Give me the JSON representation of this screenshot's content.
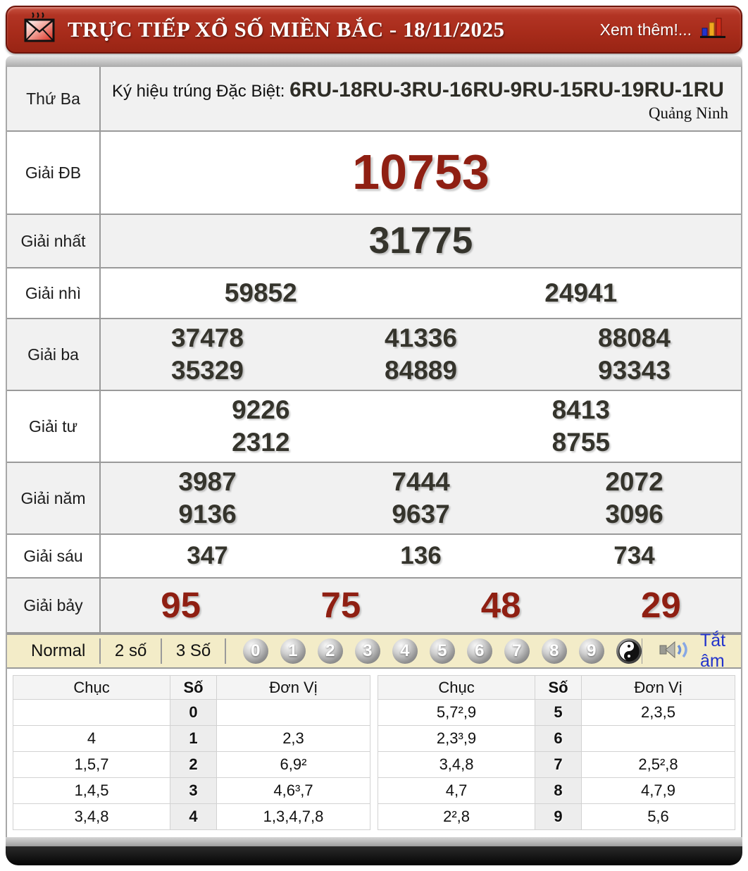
{
  "header": {
    "title": "TRỰC TIẾP XỔ SỐ MIỀN BẮC - 18/11/2025",
    "more_label": "Xem thêm!..."
  },
  "info_row": {
    "day": "Thứ Ba",
    "symbol_label": "Ký hiệu trúng Đặc Biệt: ",
    "symbol_codes": "6RU-18RU-3RU-16RU-9RU-15RU-19RU-1RU",
    "province": "Quảng Ninh"
  },
  "prizes": [
    {
      "key": "db",
      "label": "Giải ĐB",
      "rows": [
        [
          "10753"
        ]
      ]
    },
    {
      "key": "nhat",
      "label": "Giải nhất",
      "rows": [
        [
          "31775"
        ]
      ]
    },
    {
      "key": "nhi",
      "label": "Giải nhì",
      "rows": [
        [
          "59852",
          "24941"
        ]
      ]
    },
    {
      "key": "ba",
      "label": "Giải ba",
      "rows": [
        [
          "37478",
          "41336",
          "88084"
        ],
        [
          "35329",
          "84889",
          "93343"
        ]
      ]
    },
    {
      "key": "tu",
      "label": "Giải tư",
      "rows": [
        [
          "9226",
          "8413"
        ],
        [
          "2312",
          "8755"
        ]
      ]
    },
    {
      "key": "nam",
      "label": "Giải năm",
      "rows": [
        [
          "3987",
          "7444",
          "2072"
        ],
        [
          "9136",
          "9637",
          "3096"
        ]
      ]
    },
    {
      "key": "sau",
      "label": "Giải sáu",
      "rows": [
        [
          "347",
          "136",
          "734"
        ]
      ]
    },
    {
      "key": "bay",
      "label": "Giải bảy",
      "rows": [
        [
          "95",
          "75",
          "48",
          "29"
        ]
      ]
    }
  ],
  "toolbar": {
    "modes": [
      "Normal",
      "2 số",
      "3 Số"
    ],
    "digits": [
      "0",
      "1",
      "2",
      "3",
      "4",
      "5",
      "6",
      "7",
      "8",
      "9"
    ],
    "mute_label": "Tắt âm"
  },
  "stats": {
    "headers": [
      "Chục",
      "Số",
      "Đơn Vị"
    ],
    "left": [
      [
        "",
        "0",
        ""
      ],
      [
        "4",
        "1",
        "2,3"
      ],
      [
        "1,5,7",
        "2",
        "6,9²"
      ],
      [
        "1,4,5",
        "3",
        "4,6³,7"
      ],
      [
        "3,4,8",
        "4",
        "1,3,4,7,8"
      ]
    ],
    "right": [
      [
        "5,7²,9",
        "5",
        "2,3,5"
      ],
      [
        "2,3³,9",
        "6",
        ""
      ],
      [
        "3,4,8",
        "7",
        "2,5²,8"
      ],
      [
        "4,7",
        "8",
        "4,7,9"
      ],
      [
        "2²,8",
        "9",
        "5,6"
      ]
    ]
  },
  "colors": {
    "accent_red": "#8f1f12",
    "header_red": "#a82c1b",
    "toolbar_bg": "#f3ecc8",
    "link_blue": "#2233cc"
  }
}
